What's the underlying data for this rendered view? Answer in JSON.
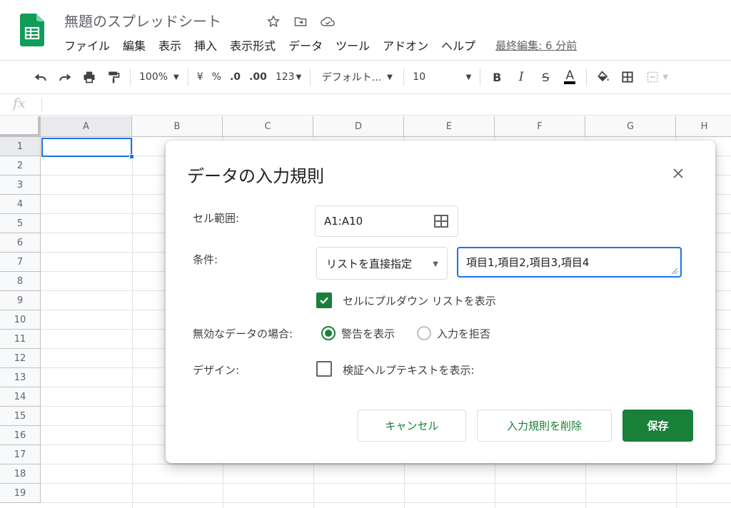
{
  "header": {
    "title": "無題のスプレッドシート",
    "menu": [
      "ファイル",
      "編集",
      "表示",
      "挿入",
      "表示形式",
      "データ",
      "ツール",
      "アドオン",
      "ヘルプ"
    ],
    "last_edit": "最終編集: 6 分前"
  },
  "toolbar": {
    "zoom": "100%",
    "currency": "¥",
    "percent": "%",
    "decimal_decrease": ".0",
    "decimal_increase": ".00",
    "number_format": "123",
    "font": "デフォルト...",
    "font_size": "10",
    "bold": "B",
    "italic": "I",
    "strike": "S",
    "text_color": "A"
  },
  "formula_bar": {
    "fx": "fx"
  },
  "grid": {
    "columns": [
      "A",
      "B",
      "C",
      "D",
      "E",
      "F",
      "G",
      "H"
    ],
    "rows": [
      "1",
      "2",
      "3",
      "4",
      "5",
      "6",
      "7",
      "8",
      "9",
      "10",
      "11",
      "12",
      "13",
      "14",
      "15",
      "16",
      "17",
      "18",
      "19"
    ]
  },
  "dialog": {
    "title": "データの入力規則",
    "range_label": "セル範囲:",
    "range_value": "A1:A10",
    "criteria_label": "条件:",
    "criteria_type": "リストを直接指定",
    "criteria_value": "項目1,項目2,項目3,項目4",
    "dropdown_checkbox": {
      "label": "セルにプルダウン リストを表示",
      "checked": true
    },
    "invalid_label": "無効なデータの場合:",
    "invalid_options": [
      {
        "label": "警告を表示",
        "selected": true
      },
      {
        "label": "入力を拒否",
        "selected": false
      }
    ],
    "appearance_label": "デザイン:",
    "help_checkbox": {
      "label": "検証ヘルプテキストを表示:",
      "checked": false
    },
    "buttons": {
      "cancel": "キャンセル",
      "remove": "入力規則を削除",
      "save": "保存"
    }
  },
  "colors": {
    "accent_green": "#188038",
    "focus_blue": "#1a73e8",
    "sheets_logo": "#0f9d58"
  }
}
